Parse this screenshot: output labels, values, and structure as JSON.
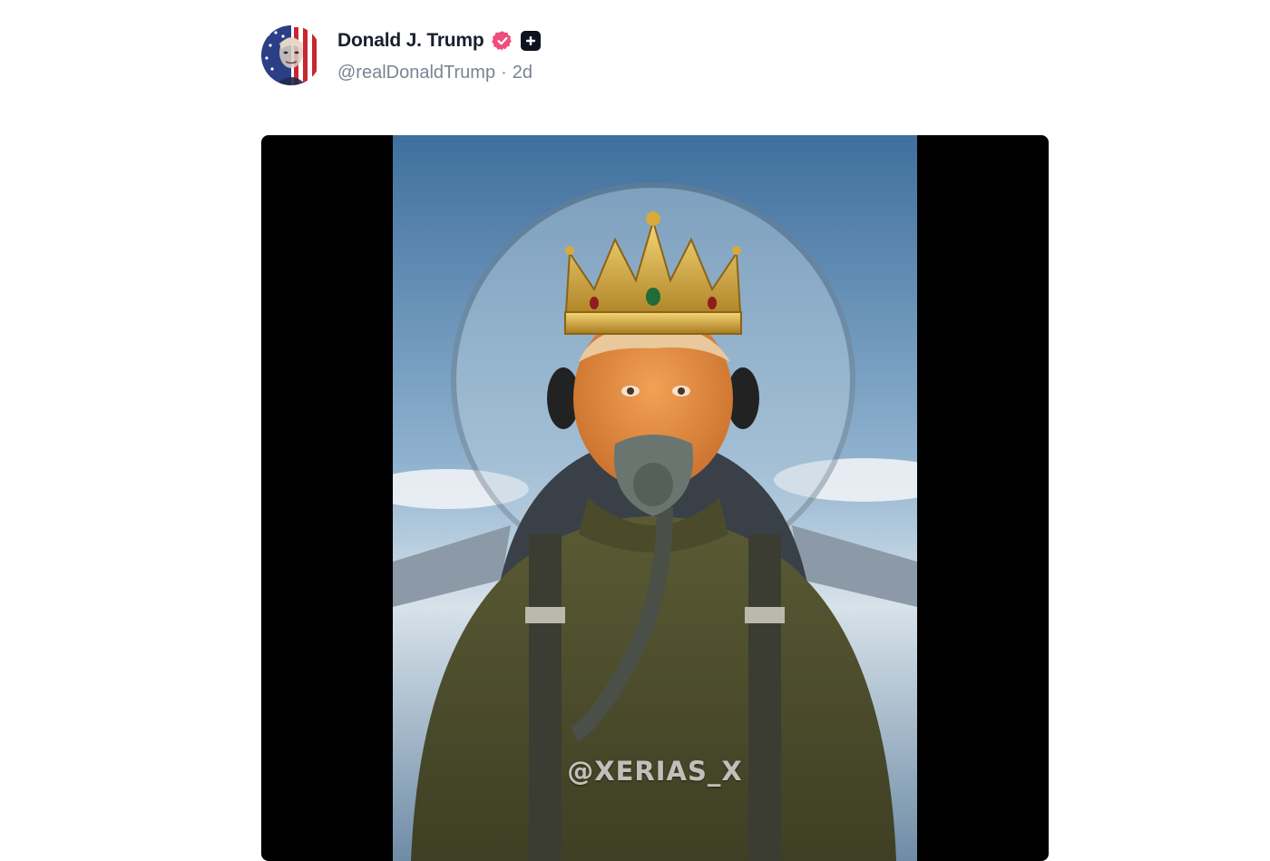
{
  "post": {
    "author": {
      "display_name": "Donald J. Trump",
      "handle": "@realDonaldTrump",
      "verified_icon": "verified-check-icon",
      "plus_icon": "plus-square-icon",
      "avatar_icon": "avatar-flag-portrait"
    },
    "separator": "·",
    "timestamp": "2d",
    "media": {
      "type": "video",
      "watermark": "@XERIAS_X"
    }
  },
  "colors": {
    "verified": "#ef4d7b",
    "name_text": "#1a1f2e",
    "meta_text": "#7c8391",
    "media_bg": "#000000"
  }
}
